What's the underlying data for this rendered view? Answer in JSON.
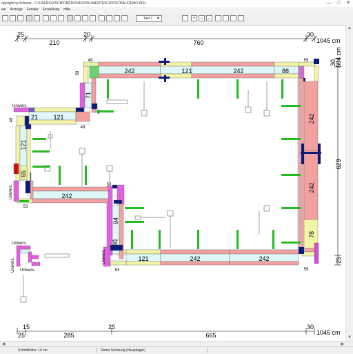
{
  "window": {
    "title": "opyright by Schewe - C:\\USERS\\VISCH\\ONEDRIVE\\DOKUMENTE\\EUROSCHAL\\DEMO.WSL",
    "minimize": "—",
    "maximize": "□",
    "close": "✕"
  },
  "menu": [
    "ien",
    "Anzeige",
    "Fenster",
    "Einstellung",
    "Hilfe"
  ],
  "toolbar": {
    "takt_select": "Takt 1",
    "zoom_in": "+",
    "zoom_out": "−",
    "select": "↔"
  },
  "dims": {
    "top_a": "25",
    "top_b": "20",
    "top_c": "30",
    "top_d": "210",
    "top_e": "760",
    "top_total": "1045 cm",
    "bot_a": "15",
    "bot_b": "25",
    "bot_c": "30",
    "bot_d": "25",
    "bot_e": "285",
    "bot_f": "665",
    "bot_total": "1045 cm",
    "right_a": "30",
    "right_b": "684 cm",
    "right_c": "629",
    "right_d": "25"
  },
  "labels": {
    "p1": "242",
    "p2": "121",
    "p3": "242",
    "p4": "88",
    "p5": "71",
    "p6": "21",
    "p7": "121",
    "p8": "121",
    "p9": "65",
    "p10": "242",
    "p11": "94",
    "p12": "30",
    "p13": "121",
    "p14": "242",
    "p15": "242",
    "r1": "242",
    "r2": "242",
    "r3": "78",
    "s49a": "49",
    "s59a": "59",
    "s59b": "59",
    "s49b": "49",
    "s49c": "49",
    "s49d": "49",
    "s53a": "53",
    "s53b": "53",
    "s53c": "53",
    "s59c": "59",
    "univ1": "Univers.",
    "univ2": "Univers.",
    "univ3": "Univers.",
    "univ4": "Univers.",
    "univ5": "Univers.",
    "univ6": "Univers."
  },
  "status": {
    "cut_height": "Schnitthöhe: 10 cm",
    "project": "Demo Schalung (Hauptlager)"
  }
}
